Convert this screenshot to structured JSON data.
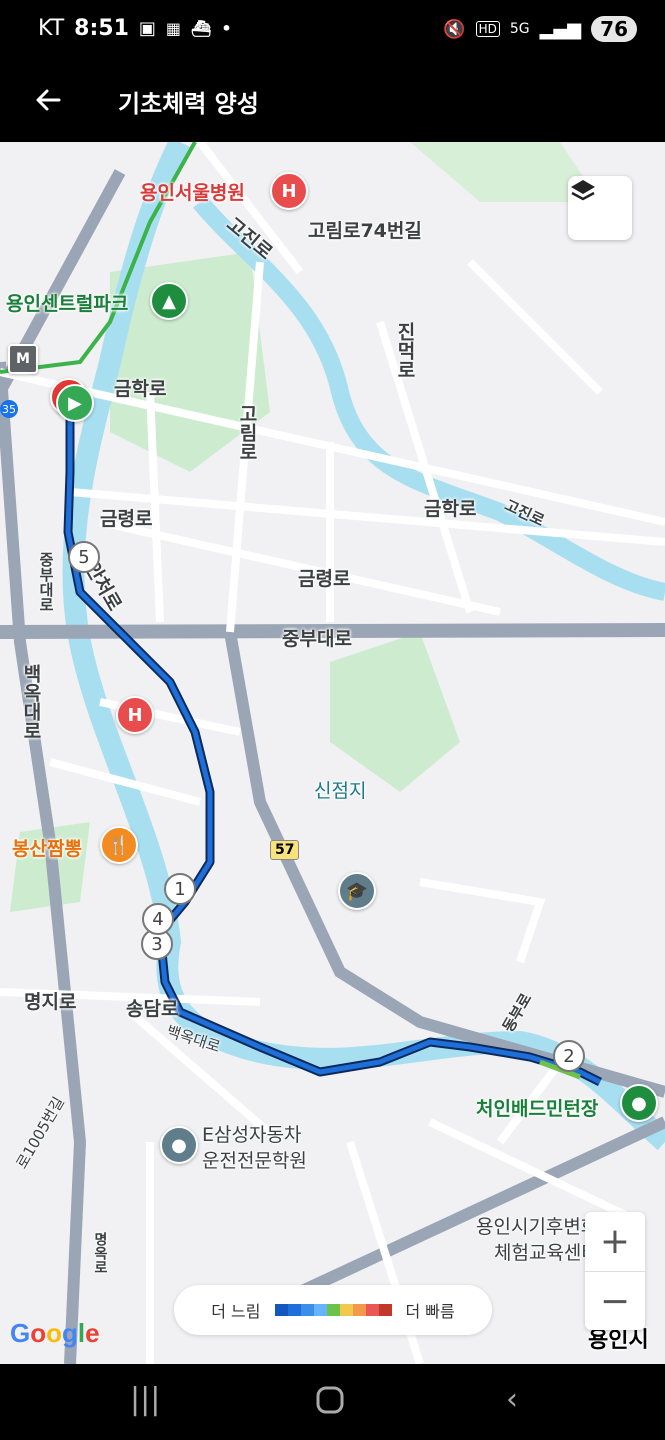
{
  "status": {
    "carrier": "KT",
    "time": "8:51",
    "battery": "76",
    "net_label": "5G",
    "hd_label": "HD"
  },
  "header": {
    "title": "기초체력 양성"
  },
  "map": {
    "labels": {
      "hospital_top": "용인서울병원",
      "central_park": "용인센트럴파크",
      "gorim74": "고림로74번길",
      "gojin_top": "고진로",
      "jinmuro": "진먹로",
      "geumhak_left": "금학로",
      "gorim": "고림로",
      "geumhak_right": "금학로",
      "gojin_right": "고진로",
      "geumryeong_left": "금령로",
      "geumryeong_right": "금령로",
      "anchiro": "안처로",
      "jungbudaero_v": "중부대로",
      "jungbudaero_h": "중부대로",
      "baekokdaero_v": "백옥대로",
      "sinjeomji": "신점지",
      "bongsan": "봉산짬뽕",
      "road57": "57",
      "myeongji": "명지로",
      "songdam": "송담로",
      "baekokdaero_s": "백옥대로",
      "dongburo": "동부로",
      "badminton": "처인배드민턴장",
      "driving_school_1": "E삼성자동차",
      "driving_school_2": "운전전문학원",
      "climate_center_1": "용인시기후변화",
      "climate_center_2": "체험교육센터",
      "road1005": "로1005번길",
      "yongin_city": "용인시",
      "left_edge_road": "명옥로",
      "badge_35": "35"
    },
    "route_markers": [
      "1",
      "2",
      "3",
      "4",
      "5"
    ]
  },
  "legend": {
    "slower": "더 느림",
    "faster": "더 빠름",
    "colors": [
      "#1557c0",
      "#1e6fd9",
      "#3a8fe8",
      "#66b3ff",
      "#6cc24a",
      "#f2c94c",
      "#f2994a",
      "#eb5757",
      "#c0392b"
    ]
  },
  "zoom": {
    "plus": "+",
    "minus": "−"
  },
  "attribution": "Google"
}
